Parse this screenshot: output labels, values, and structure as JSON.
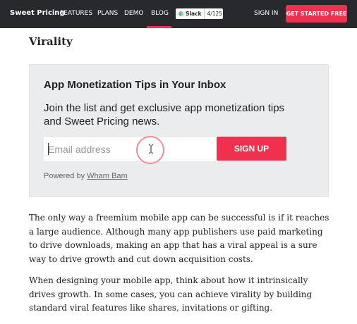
{
  "nav": {
    "brand": "Sweet Pricing",
    "links": [
      "FEATURES",
      "PLANS",
      "DEMO",
      "BLOG"
    ],
    "active": "BLOG",
    "slack": {
      "label": "Slack",
      "count": "4/125"
    },
    "signin": "SIGN IN",
    "cta": "GET STARTED FREE"
  },
  "article": {
    "heading": "Virality",
    "paragraphs": [
      "The only way a freemium mobile app can be successful is if it reaches a large audience. Although many app publishers use paid marketing to drive downloads, making an app that has a viral appeal is a sure way to drive growth and cut down acquisition costs.",
      "When designing your mobile app, think about how it intrinsically drives growth. In some cases, you can achieve virality by building standard viral features like shares, invitations or gifting."
    ]
  },
  "newsletter": {
    "title": "App Monetization Tips in Your Inbox",
    "description": "Join the list and get exclusive app monetization tips and Sweet Pricing news.",
    "email_placeholder": "Email address",
    "email_value": "",
    "submit": "SIGN UP",
    "powered_prefix": "Powered by",
    "powered_link": "Wham Bam"
  },
  "colors": {
    "nav_bg": "#27292d",
    "accent": "#f0304e",
    "box_bg": "#eaecee"
  },
  "icons": {
    "slack": "slack-logo-icon",
    "cursor": "text-cursor-icon"
  }
}
